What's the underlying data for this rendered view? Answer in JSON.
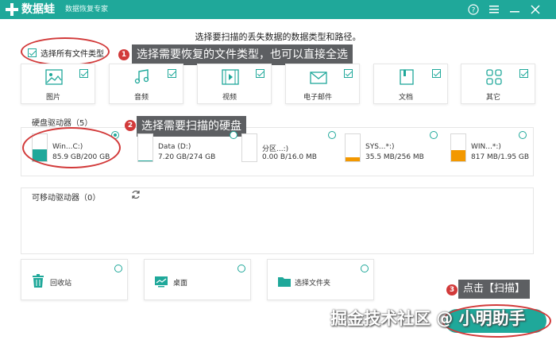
{
  "app": {
    "name": "数据蛙",
    "subtitle": "数据恢复专家",
    "brand_color": "#1fa89a"
  },
  "window_controls": [
    "help-icon",
    "menu-icon",
    "minimize-icon",
    "close-icon"
  ],
  "instruction": "选择要扫描的丢失数据的数据类型和路径。",
  "select_all": {
    "label": "选择所有文件类型",
    "checked": true
  },
  "file_types": [
    {
      "label": "图片",
      "icon": "image-icon",
      "checked": true
    },
    {
      "label": "音频",
      "icon": "music-icon",
      "checked": true
    },
    {
      "label": "视频",
      "icon": "video-icon",
      "checked": true
    },
    {
      "label": "电子邮件",
      "icon": "email-icon",
      "checked": true
    },
    {
      "label": "文档",
      "icon": "document-icon",
      "checked": true
    },
    {
      "label": "其它",
      "icon": "apps-icon",
      "checked": true
    }
  ],
  "hard_drives": {
    "label": "硬盘驱动器（5）",
    "drives": [
      {
        "name": "Win...C:)",
        "size": "85.9 GB/200 GB",
        "used_fraction": 0.43,
        "selected": true
      },
      {
        "name": "Data (D:)",
        "size": "7.20 GB/274 GB",
        "used_fraction": 0.03,
        "selected": false
      },
      {
        "name": "分区...:)",
        "size": "0.00  B/16.0 MB",
        "used_fraction": 0.0,
        "selected": false
      },
      {
        "name": "SYS...*:)",
        "size": "35.5 MB/256 MB",
        "used_fraction": 0.14,
        "selected": false
      },
      {
        "name": "WIN...*:)",
        "size": "817 MB/1.95 GB",
        "used_fraction": 0.42,
        "selected": false
      }
    ]
  },
  "removable": {
    "label": "可移动驱动器（0）"
  },
  "locations": [
    {
      "label": "回收站",
      "icon": "trash-icon"
    },
    {
      "label": "桌面",
      "icon": "desktop-icon"
    },
    {
      "label": "选择文件夹",
      "icon": "folder-icon"
    }
  ],
  "callouts": [
    {
      "number": "1",
      "text": "选择需要恢复的文件类型，也可以直接全选"
    },
    {
      "number": "2",
      "text": "选择需要扫描的硬盘"
    },
    {
      "number": "3",
      "text": "点击【扫描】"
    }
  ],
  "watermark": "掘金技术社区 @ 小明助手",
  "colors": {
    "accent": "#1fa89a",
    "annotation": "#d23a3a",
    "drive_small_fill": "#f39800"
  }
}
